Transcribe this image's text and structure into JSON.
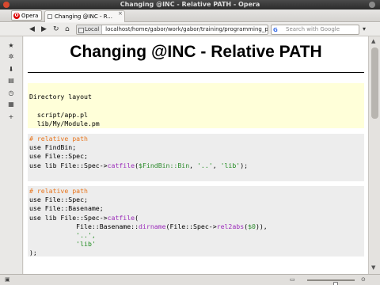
{
  "window": {
    "title": "Changing @INC - Relative PATH - Opera"
  },
  "tabbar": {
    "menu_label": "Opera",
    "tab_title": "Changing @INC - R...",
    "tab_close": "×"
  },
  "navbar": {
    "back": "◀",
    "forward": "▶",
    "reload": "↻",
    "home": "⌂",
    "address_badge": "Local",
    "address": "localhost/home/gabor/work/gabor/training/programming_perl",
    "search_placeholder": "Search with Google",
    "search_engine": "G",
    "go": "▾"
  },
  "sidebar": {
    "icons": [
      "star-icon",
      "gear-icon",
      "download-icon",
      "notes-icon",
      "history-icon",
      "widgets-icon",
      "plus-icon"
    ]
  },
  "slide": {
    "title": "Changing @INC - Relative PATH",
    "directory": {
      "heading": "Directory layout",
      "lines": [
        "  script/app.pl",
        "  lib/My/Module.pm"
      ]
    },
    "code1": {
      "comment": "# relative path",
      "line1": "use FindBin;",
      "line2": "use File::Spec;",
      "line3_a": "use lib File::Spec->",
      "line3_fn": "catfile",
      "line3_b": "(",
      "line3_var": "$FindBin::Bin",
      "line3_c": ", ",
      "line3_s1": "'..'",
      "line3_d": ", ",
      "line3_s2": "'lib'",
      "line3_e": ");"
    },
    "code2": {
      "comment": "# relative path",
      "line1": "use File::Spec;",
      "line2": "use File::Basename;",
      "line3_a": "use lib File::Spec->",
      "line3_fn": "catfile",
      "line3_b": "(",
      "line4_a": "            File::Basename::",
      "line4_fn1": "dirname",
      "line4_b": "(File::Spec->",
      "line4_fn2": "rel2abs",
      "line4_c": "(",
      "line4_var": "$0",
      "line4_d": ")),",
      "line5_s": "            '..',",
      "line6_s": "            'lib'",
      "line6_e": ");"
    }
  },
  "status": {
    "zoom_level": 0.6
  },
  "colors": {
    "comment": "#e8761e",
    "function": "#9c2dbb",
    "string": "#1c8a1c",
    "dir_bg": "#ffffd9",
    "code_bg": "#ededed"
  }
}
